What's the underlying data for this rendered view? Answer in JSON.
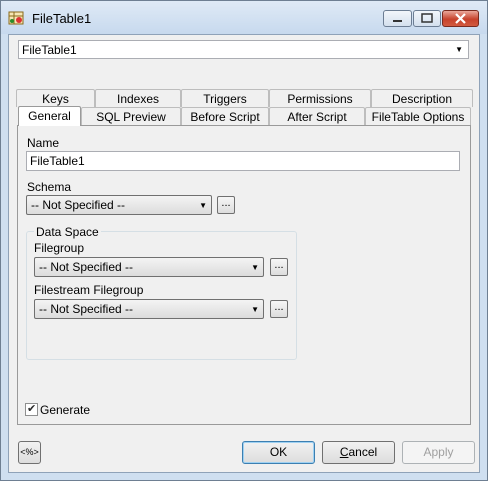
{
  "window": {
    "title": "FileTable1"
  },
  "object_selector": {
    "value": "FileTable1"
  },
  "tabs": {
    "row1": [
      "Keys",
      "Indexes",
      "Triggers",
      "Permissions",
      "Description"
    ],
    "row2": [
      "General",
      "SQL Preview",
      "Before Script",
      "After Script",
      "FileTable Options"
    ],
    "active": "General"
  },
  "general": {
    "name_label": "Name",
    "name_value": "FileTable1",
    "schema_label": "Schema",
    "schema_value": "-- Not Specified --",
    "data_space": {
      "title": "Data Space",
      "filegroup_label": "Filegroup",
      "filegroup_value": "-- Not Specified --",
      "filestream_label": "Filestream Filegroup",
      "filestream_value": "-- Not Specified --"
    },
    "generate_label": "Generate",
    "generate_checked": true
  },
  "ellipsis_label": "...",
  "buttons": {
    "ok": "OK",
    "cancel_first": "C",
    "cancel_rest": "ancel",
    "apply": "Apply"
  },
  "bottom_icon_glyph": "<%>",
  "colors": {
    "title_bg": "#c7d9ee",
    "close_red": "#c7422c",
    "panel_bg": "#f0f0f0"
  }
}
